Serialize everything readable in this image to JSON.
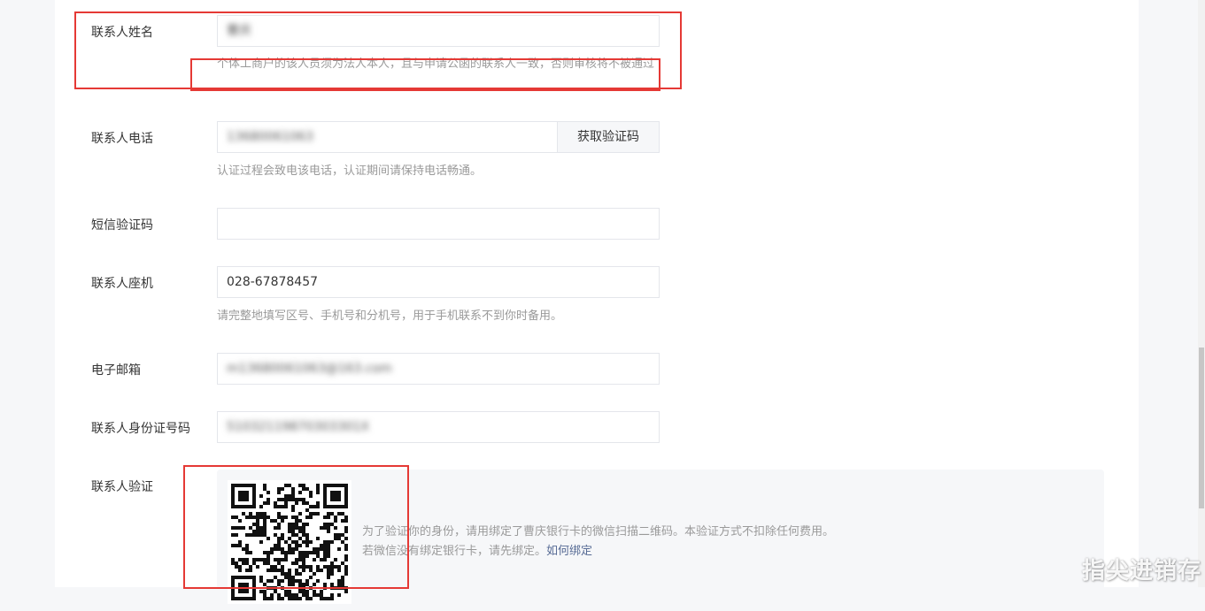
{
  "form": {
    "contact_name": {
      "label": "联系人姓名",
      "value": "曹庆",
      "hint": "个体工商户的该人员须为法人本人，且与申请公函的联系人一致，否则审核将不被通过"
    },
    "contact_phone": {
      "label": "联系人电话",
      "value": "13680061063",
      "button": "获取验证码",
      "hint": "认证过程会致电该电话，认证期间请保持电话畅通。"
    },
    "sms_code": {
      "label": "短信验证码",
      "value": ""
    },
    "landline": {
      "label": "联系人座机",
      "value": "028-67878457",
      "hint": "请完整地填写区号、手机号和分机号，用于手机联系不到你时备用。"
    },
    "email": {
      "label": "电子邮箱",
      "value": "m13680061063@163.com"
    },
    "id_number": {
      "label": "联系人身份证号码",
      "value": "51032119870303301X"
    },
    "verify": {
      "label": "联系人验证",
      "line1": "为了验证你的身份，请用绑定了曹庆银行卡的微信扫描二维码。本验证方式不扣除任何费用。",
      "line2_prefix": "若微信没有绑定银行卡，请先绑定。",
      "line2_link": "如何绑定"
    }
  },
  "watermark": "指尖进销存",
  "colors": {
    "annotation": "#e53935",
    "link": "#576b95",
    "hint": "#9a9a9a"
  }
}
